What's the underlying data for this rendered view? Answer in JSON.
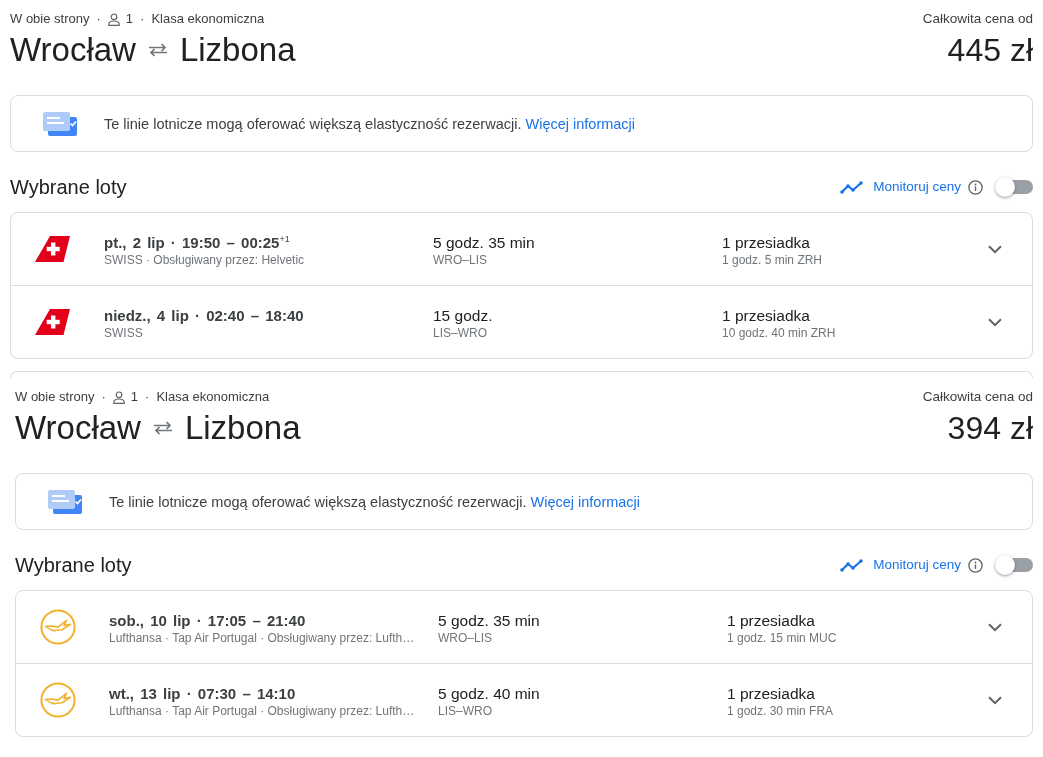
{
  "panels": [
    {
      "summary": [
        {
          "kind": "trip_type",
          "text": "W obie strony"
        },
        {
          "kind": "separator",
          "text": "·"
        },
        {
          "kind": "passengers",
          "text": "1"
        },
        {
          "kind": "separator",
          "text": "·"
        },
        {
          "kind": "cabin",
          "text": "Klasa ekonomiczna"
        }
      ],
      "origin": "Wrocław",
      "destination": "Lizbona",
      "price_label": "Całkowita cena od",
      "price": "445 zł",
      "notice": {
        "message": "Te linie lotnicze mogą oferować większą elastyczność rezerwacji.",
        "link": "Więcej informacji"
      },
      "section": {
        "heading": "Wybrane loty",
        "track_prices": {
          "label": "Monitoruj ceny",
          "on": false
        }
      },
      "flights": [
        {
          "kind": "tail",
          "when": "pt., 2 lip · 19:50 – 00:25$^{+1}$",
          "airlines": "SWISS · Obsługiwany przez: Helvetic",
          "duration": "5 godz. 35 min",
          "route": "WRO–LIS",
          "stops": "1 przesiadka",
          "layover": "1 godz. 5 min ZRH",
          "expanded": false
        },
        {
          "kind": "tail",
          "when": "niedz., 4 lip · 02:40 – 18:40",
          "airlines": "SWISS",
          "duration": "15 godz.",
          "route": "LIS–WRO",
          "stops": "1 przesiadka",
          "layover": "10 godz. 40 min ZRH",
          "expanded": false
        }
      ]
    },
    {
      "summary": [
        {
          "kind": "trip_type",
          "text": "W obie strony"
        },
        {
          "kind": "separator",
          "text": "·"
        },
        {
          "kind": "passengers",
          "text": "1"
        },
        {
          "kind": "separator",
          "text": "·"
        },
        {
          "kind": "cabin",
          "text": "Klasa ekonomiczna"
        }
      ],
      "origin": "Wrocław",
      "destination": "Lizbona",
      "price_label": "Całkowita cena od",
      "price": "394 zł",
      "notice": {
        "message": "Te linie lotnicze mogą oferować większą elastyczność rezerwacji.",
        "link": "Więcej informacji"
      },
      "section": {
        "heading": "Wybrane loty",
        "track_prices": {
          "label": "Monitoruj ceny",
          "on": false
        }
      },
      "flights": [
        {
          "kind": "ring",
          "when": "sob., 10 lip · 17:05 – 21:40",
          "airlines": "Lufthansa · Tap Air Portugal · Obsługiwany przez: Lufth…",
          "duration": "5 godz. 35 min",
          "route": "WRO–LIS",
          "stops": "1 przesiadka",
          "layover": "1 godz. 15 min MUC",
          "expanded": false
        },
        {
          "kind": "ring",
          "when": "wt., 13 lip · 07:30 – 14:10",
          "airlines": "Lufthansa · Tap Air Portugal · Obsługiwany przez: Lufth…",
          "duration": "5 godz. 40 min",
          "route": "LIS–WRO",
          "stops": "1 przesiadka",
          "layover": "1 godz. 30 min FRA",
          "expanded": false
        }
      ]
    }
  ]
}
